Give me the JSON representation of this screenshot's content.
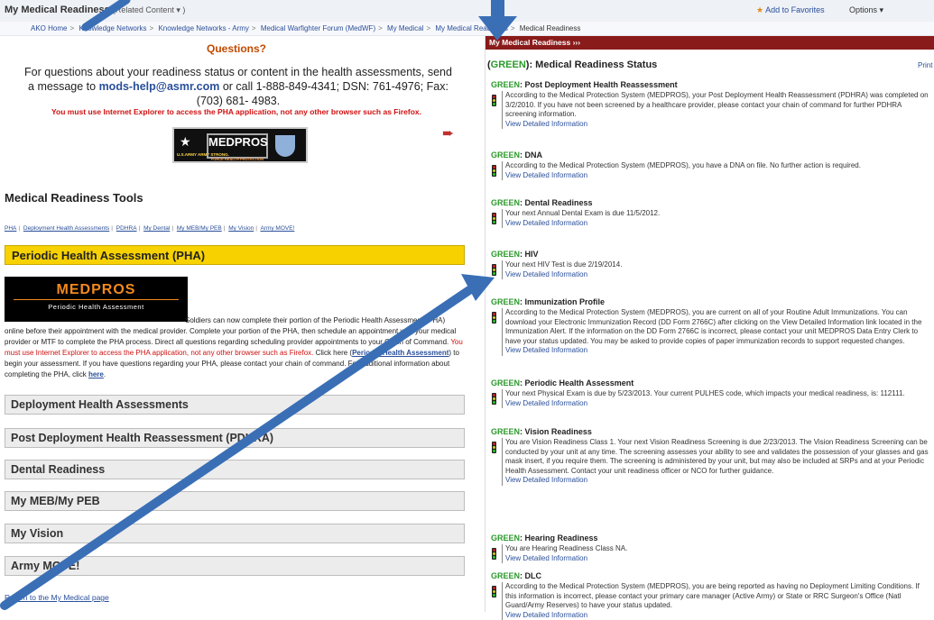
{
  "topbar": {
    "title": "My Medical Readiness",
    "related": "(Related Content ▾ )",
    "favorites": "Add to Favorites",
    "options": "Options ▾"
  },
  "breadcrumbs": [
    "AKO Home",
    "Knowledge Networks",
    "Knowledge Networks - Army",
    "Medical Warfighter Forum (MedWF)",
    "My Medical",
    "My Medical Readiness",
    "Medical Readiness"
  ],
  "left": {
    "questions_title": "Questions?",
    "questions_text_1": "For questions about your readiness status or content in the health assessments, send a message to",
    "questions_email": "mods-help@asmr.com",
    "questions_text_2": "or call 1-888-849-4341; DSN: 761-4976; Fax: (703) 681- 4983.",
    "ie_warning": "You must use Internet Explorer to access the PHA application, not any other browser such as Firefox.",
    "logo": {
      "army": "U.S.ARMY ARMY STRONG.",
      "medpros": "MEDPROS",
      "sub": "FORCE HEALTH PROTECTION"
    },
    "tools_heading": "Medical Readiness Tools",
    "tools_links": [
      "PHA",
      "Deployment Health Assessments",
      "PDHRA",
      "My Dental",
      "My MEB/My PEB",
      "My Vision",
      "Army MOVE!"
    ],
    "pha_heading": "Periodic Health Assessment (PHA)",
    "pha_logo_title": "MEDPROS",
    "pha_logo_sub": "Periodic Health Assessment",
    "pha_text_1": "Soldiers can now complete their portion of the Periodic Health Assessment (PHA) online before their appointment with the medical provider. Complete your portion of the PHA, then schedule an appointment with your medical provider or MTF to complete the PHA process. Direct all questions regarding scheduling provider appointments to your Chain of Command.",
    "pha_text_red": "You must use Internet Explorer to access the PHA application, not any other browser such as Firefox.",
    "pha_text_2": "Click here (",
    "pha_link": "Periodic Health Assessment",
    "pha_text_3": ") to begin your assessment. If you have questions regarding your PHA, please contact your chain of command. For additional information about completing the PHA, click",
    "pha_here": "here",
    "sections": [
      "Deployment Health Assessments",
      "Post Deployment Health Reassessment (PDHRA)",
      "Dental Readiness",
      "My MEB/My PEB",
      "My Vision",
      "Army MOVE!"
    ],
    "return_link": "Return to the My Medical page"
  },
  "right": {
    "header": "My Medical Readiness ›››",
    "status_prefix": "(",
    "status_green": "GREEN",
    "status_suffix": "): Medical Readiness Status",
    "print": "Print",
    "items": [
      {
        "status": "GREEN",
        "title": ": Post Deployment Health Reassessment",
        "text": "According to the Medical Protection System (MEDPROS), your Post Deployment Health Reassessment (PDHRA) was completed on 3/2/2010. If you have not been screened by a healthcare provider, please contact your chain of command for further PDHRA screening information.",
        "link": "View Detailed Information"
      },
      {
        "status": "GREEN",
        "title": ": DNA",
        "text": "According to the Medical Protection System (MEDPROS), you have a DNA on file. No further action is required.",
        "link": "View Detailed Information"
      },
      {
        "status": "GREEN",
        "title": ": Dental Readiness",
        "text": "Your next Annual Dental Exam is due 11/5/2012.",
        "link": "View Detailed Information"
      },
      {
        "status": "GREEN",
        "title": ": HIV",
        "text": "Your next HIV Test is due 2/19/2014.",
        "link": "View Detailed Information"
      },
      {
        "status": "GREEN",
        "title": ": Immunization Profile",
        "text": "According to the Medical Protection System (MEDPROS), you are current on all of your Routine Adult Immunizations. You can download your Electronic Immunization Record (DD Form 2766C) after clicking on the View Detailed Information link located in the Immunization Alert. If the information on the DD Form 2766C is incorrect, please contact your unit MEDPROS Data Entry Clerk to have your status updated. You may be asked to provide copies of paper immunization records to support requested changes.",
        "link": "View Detailed Information"
      },
      {
        "status": "GREEN",
        "title": ": Periodic Health Assessment",
        "text": "Your next Physical Exam is due by 5/23/2013. Your current PULHES code, which impacts your medical readiness, is: 112111.",
        "link": "View Detailed Information"
      },
      {
        "status": "GREEN",
        "title": ": Vision Readiness",
        "text": "You are Vision Readiness Class 1. Your next Vision Readiness Screening is due 2/23/2013. The Vision Readiness Screening can be conducted by your unit at any time. The screening assesses your ability to see and validates the possession of your glasses and gas mask insert, if you require them. The screening is administered by your unit, but may also be included at SRPs and at your Periodic Health Assessment. Contact your unit readiness officer or NCO for further guidance.",
        "link": "View Detailed Information"
      },
      {
        "status": "GREEN",
        "title": ": Hearing Readiness",
        "text": "You are Hearing Readiness Class NA.",
        "link": "View Detailed Information"
      },
      {
        "status": "GREEN",
        "title": ": DLC",
        "text": "According to the Medical Protection System (MEDPROS), you are being reported as having no Deployment Limiting Conditions. If this information is incorrect, please contact your primary care manager (Active Army) or State or RRC Surgeon's Office (Natl Guard/Army Reserves) to have your status updated.",
        "link": "View Detailed Information"
      }
    ]
  },
  "colors": {
    "arrow": "#3a6fb6",
    "header_bar": "#8a1b1b",
    "pha_bar": "#f7d200",
    "green": "#2a9a2a",
    "link": "#2a4f9a"
  },
  "annotation_arrows": [
    "arrow-top-left",
    "arrow-top-right",
    "arrow-diagonal"
  ]
}
